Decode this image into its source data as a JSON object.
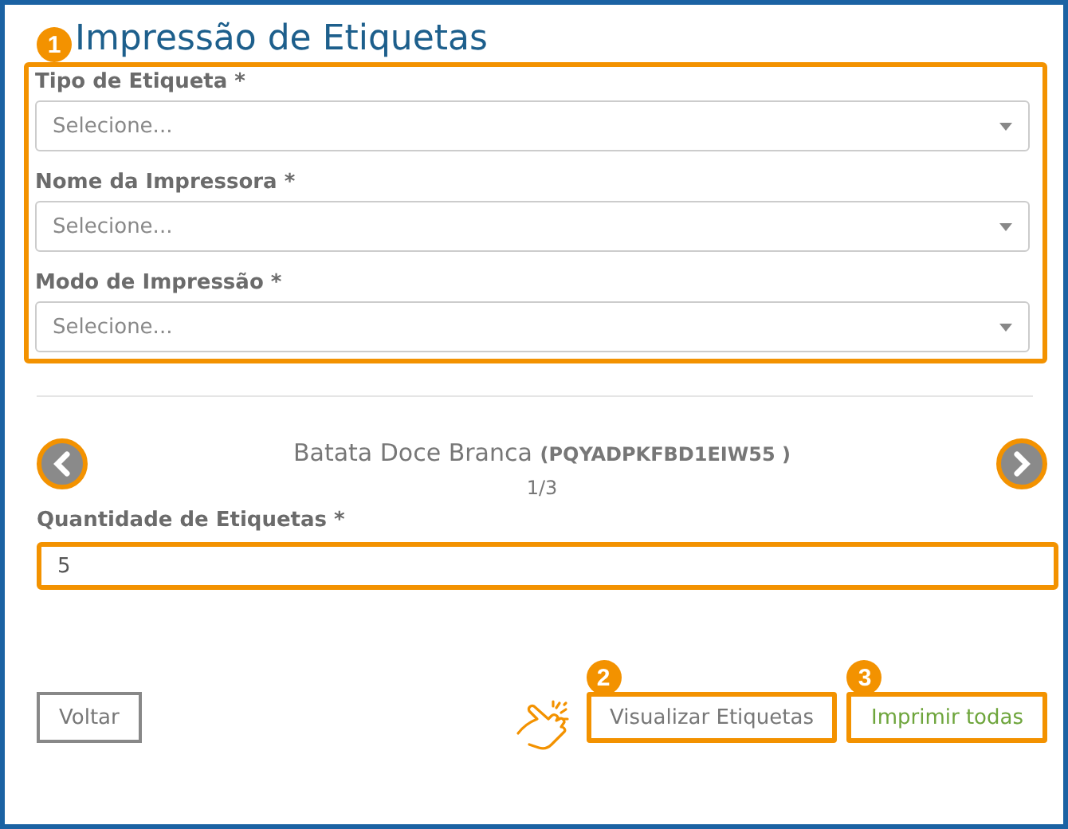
{
  "title": "Impressão de Etiquetas",
  "form_badge": "1",
  "selects": [
    {
      "label": "Tipo de Etiqueta *",
      "placeholder": "Selecione..."
    },
    {
      "label": "Nome da Impressora *",
      "placeholder": "Selecione..."
    },
    {
      "label": "Modo de Impressão *",
      "placeholder": "Selecione..."
    }
  ],
  "product": {
    "name": "Batata Doce Branca",
    "code": "(PQYADPKFBD1EIW55 )",
    "position": "1/3"
  },
  "quantity": {
    "label": "Quantidade de Etiquetas *",
    "value": "5"
  },
  "buttons": [
    {
      "label": "Voltar",
      "kind": "plain"
    },
    {
      "label": "Visualizar Etiquetas",
      "kind": "highlight",
      "badge": "2"
    },
    {
      "label": "Imprimir todas",
      "kind": "primary",
      "badge": "3"
    }
  ]
}
